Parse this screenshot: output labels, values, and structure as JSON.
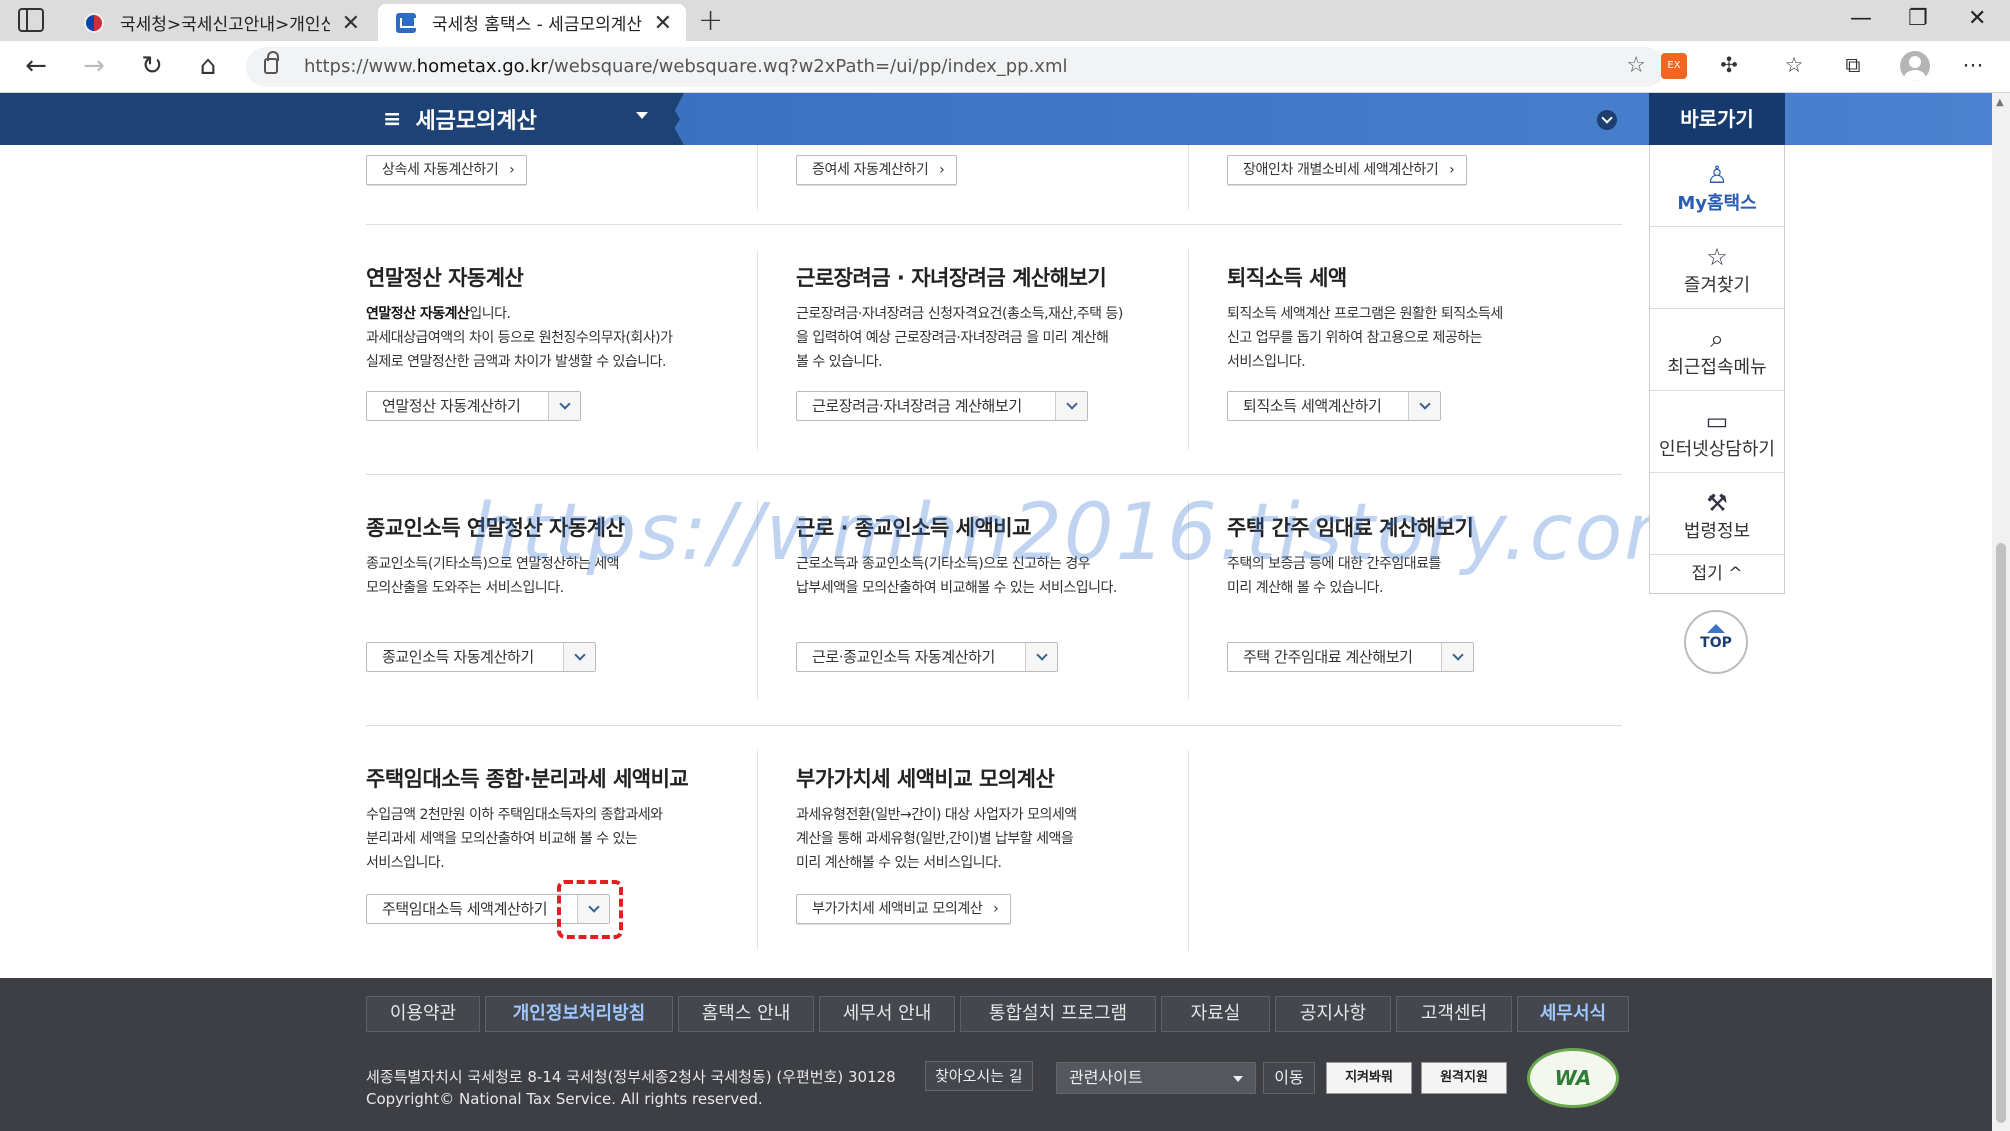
{
  "browser": {
    "tabs": [
      {
        "label": "국세청>국세신고안내>개인신고안내>",
        "active": false
      },
      {
        "label": "국세청 홈택스 - 세금모의계산",
        "active": true
      }
    ],
    "url_prefix": "https://www.",
    "url_host": "hometax.go.kr",
    "url_path": "/websquare/websquare.wq?w2xPath=/ui/pp/index_pp.xml",
    "extension_label": "EX"
  },
  "menu": {
    "title": "세금모의계산"
  },
  "quick": {
    "header": "바로가기",
    "items": [
      {
        "label": "My홈택스",
        "icon": "user-icon"
      },
      {
        "label": "즐겨찾기",
        "icon": "star-icon"
      },
      {
        "label": "최근접속메뉴",
        "icon": "recent-menu-icon"
      },
      {
        "label": "인터넷상담하기",
        "icon": "laptop-icon"
      },
      {
        "label": "법령정보",
        "icon": "gavel-icon"
      }
    ],
    "fold": "접기",
    "top": "TOP"
  },
  "row0": [
    {
      "button": "상속세 자동계산하기"
    },
    {
      "button": "증여세 자동계산하기"
    },
    {
      "button": "장애인차 개별소비세 세액계산하기"
    }
  ],
  "cards": [
    {
      "title": "연말정산 자동계산",
      "desc_bold": "연말정산 자동계산",
      "desc_after": "입니다.",
      "desc": "과세대상급여액의 차이 등으로 원천징수의무자(회사)가\n실제로 연말정산한 금액과 차이가 발생할 수 있습니다.",
      "button": "연말정산 자동계산하기"
    },
    {
      "title": "근로장려금 · 자녀장려금 계산해보기",
      "desc": "근로장려금·자녀장려금 신청자격요건(총소득,재산,주택 등)\n을 입력하여 예상 근로장려금·자녀장려금 을 미리 계산해\n볼 수 있습니다.",
      "button": "근로장려금·자녀장려금 계산해보기"
    },
    {
      "title": "퇴직소득 세액",
      "desc": "퇴직소득 세액계산 프로그램은 원활한 퇴직소득세\n신고 업무를 돕기 위하여 참고용으로 제공하는\n서비스입니다.",
      "button": "퇴직소득 세액계산하기"
    },
    {
      "title": "종교인소득 연말정산 자동계산",
      "desc": "종교인소득(기타소득)으로 연말정산하는 세액\n모의산출을 도와주는 서비스입니다.",
      "button": "종교인소득 자동계산하기"
    },
    {
      "title": "근로 · 종교인소득 세액비교",
      "desc": "근로소득과 종교인소득(기타소득)으로 신고하는 경우\n납부세액을 모의산출하여 비교해볼 수 있는 서비스입니다.",
      "button": "근로·종교인소득 자동계산하기"
    },
    {
      "title": "주택 간주 임대료 계산해보기",
      "desc": "주택의 보증금 등에 대한 간주임대료를\n미리 계산해 볼 수 있습니다.",
      "button": "주택 간주임대료 계산해보기"
    },
    {
      "title": "주택임대소득 종합·분리과세 세액비교",
      "desc": "수입금액 2천만원 이하 주택임대소득자의 종합과세와\n분리과세 세액을 모의산출하여 비교해 볼 수 있는\n서비스입니다.",
      "button": "주택임대소득 세액계산하기"
    },
    {
      "title": "부가가치세 세액비교 모의계산",
      "desc": "과세유형전환(일반→간이) 대상 사업자가 모의세액\n계산을 통해 과세유형(일반,간이)별 납부할 세액을\n미리 계산해볼 수 있는 서비스입니다.",
      "button": "부가가치세 세액비교 모의계산"
    }
  ],
  "watermark": "https://wmhn2016.tistory.com",
  "footer": {
    "nav": [
      "이용약관",
      "개인정보처리방침",
      "홈택스 안내",
      "세무서 안내",
      "통합설치 프로그램",
      "자료실",
      "공지사항",
      "고객센터",
      "세무서식"
    ],
    "address": "세종특별자치시 국세청로 8-14 국세청(정부세종2청사 국세청동) (우편번호) 30128",
    "find_btn": "찾아오시는 길",
    "copyright": "Copyright© National Tax Service. All rights reserved.",
    "related_select": "관련사이트",
    "go_btn": "이동",
    "badge1": "지켜봐뭐",
    "badge2": "원격지원",
    "wa": "WA"
  },
  "colors": {
    "navy": "#1d4275",
    "band_blue": "#4b82cf",
    "highlight_red": "#e02020",
    "footer_bg": "#3d3f44"
  }
}
